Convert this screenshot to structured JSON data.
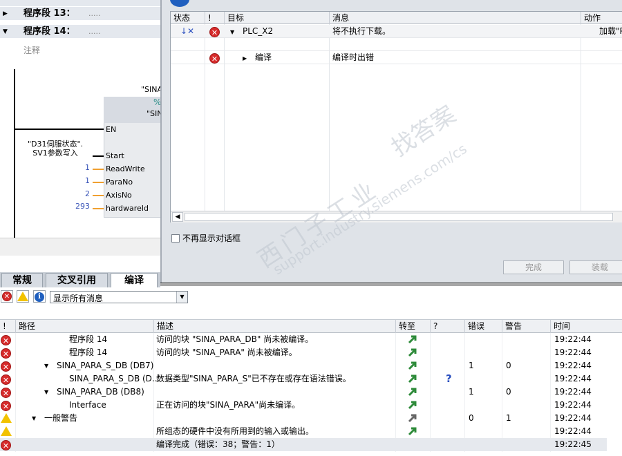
{
  "editor": {
    "segments": [
      {
        "label": "程序段 13：",
        "dots": "....."
      },
      {
        "label": "程序段 14：",
        "dots": "....."
      }
    ],
    "comment": "注释",
    "sina_top": "\"SINA",
    "fb_pct": "%",
    "fb_name": "\"SIN",
    "pins": [
      "EN",
      "Start",
      "ReadWrite",
      "ParaNo",
      "AxisNo",
      "hardwareId"
    ],
    "start_param": "\"D31伺服状态\".\nSV1参数写入",
    "values": [
      "1",
      "1",
      "2",
      "293"
    ]
  },
  "dialog": {
    "columns": [
      "状态",
      "!",
      "目标",
      "消息",
      "动作"
    ],
    "rows": [
      {
        "target": "PLC_X2",
        "message": "将不执行下载。",
        "action": "加载\"Pl"
      },
      {
        "target": "编译",
        "message": "编译时出错",
        "action": ""
      }
    ],
    "dont_show": "不再显示对话框",
    "finish_button": "完成",
    "load_button": "装载"
  },
  "tabs": [
    "常规",
    "交叉引用",
    "编译"
  ],
  "filter": {
    "selected": "显示所有消息"
  },
  "messages": {
    "columns": [
      "!",
      "路径",
      "描述",
      "转至",
      "?",
      "错误",
      "警告",
      "时间"
    ],
    "rows": [
      {
        "icon": "error",
        "path": "程序段 14",
        "indent": 3,
        "expand": "",
        "desc": "访问的块 \"SINA_PARA_DB\" 尚未被编译。",
        "goto": "green",
        "help": "",
        "errors": "",
        "warnings": "",
        "time": "19:22:44"
      },
      {
        "icon": "error",
        "path": "程序段 14",
        "indent": 3,
        "expand": "",
        "desc": "访问的块 \"SINA_PARA\" 尚未被编译。",
        "goto": "green",
        "help": "",
        "errors": "",
        "warnings": "",
        "time": "19:22:44"
      },
      {
        "icon": "error",
        "path": "SINA_PARA_S_DB (DB7)",
        "indent": 2,
        "expand": "▼",
        "desc": "",
        "goto": "green",
        "help": "",
        "errors": "1",
        "warnings": "0",
        "time": "19:22:44"
      },
      {
        "icon": "error",
        "path": "SINA_PARA_S_DB (D...",
        "indent": 3,
        "expand": "",
        "desc": "数据类型\"SINA_PARA_S\"已不存在或存在语法错误。",
        "goto": "green",
        "help": "?",
        "errors": "",
        "warnings": "",
        "time": "19:22:44"
      },
      {
        "icon": "error",
        "path": "SINA_PARA_DB (DB8)",
        "indent": 2,
        "expand": "▼",
        "desc": "",
        "goto": "green",
        "help": "",
        "errors": "1",
        "warnings": "0",
        "time": "19:22:44"
      },
      {
        "icon": "error",
        "path": "Interface",
        "indent": 3,
        "expand": "",
        "desc": "正在访问的块\"SINA_PARA\"尚未编译。",
        "goto": "green",
        "help": "",
        "errors": "",
        "warnings": "",
        "time": "19:22:44"
      },
      {
        "icon": "warning",
        "path": "一般警告",
        "indent": 1,
        "expand": "▼",
        "desc": "",
        "goto": "gray",
        "help": "",
        "errors": "0",
        "warnings": "1",
        "time": "19:22:44"
      },
      {
        "icon": "warning",
        "path": "",
        "indent": 3,
        "expand": "",
        "desc": "所组态的硬件中没有所用到的输入或输出。",
        "goto": "green",
        "help": "",
        "errors": "",
        "warnings": "",
        "time": "19:22:44"
      },
      {
        "icon": "error",
        "path": "",
        "indent": 3,
        "expand": "",
        "desc": "编译完成（错误：38；警告：1）",
        "goto": "",
        "help": "",
        "errors": "",
        "warnings": "",
        "time": "19:22:45"
      }
    ]
  },
  "watermark": {
    "line1": "西门子工业",
    "line2": "support.industry.siemens.com/cs",
    "line3": "找答案"
  },
  "colors": {
    "error": "#d62b2b",
    "warning": "#f2c200",
    "info": "#1f5fbf",
    "goto_green": "#2e8b3a",
    "value_blue": "#3a55b8",
    "wire_orange": "#f0a030"
  }
}
